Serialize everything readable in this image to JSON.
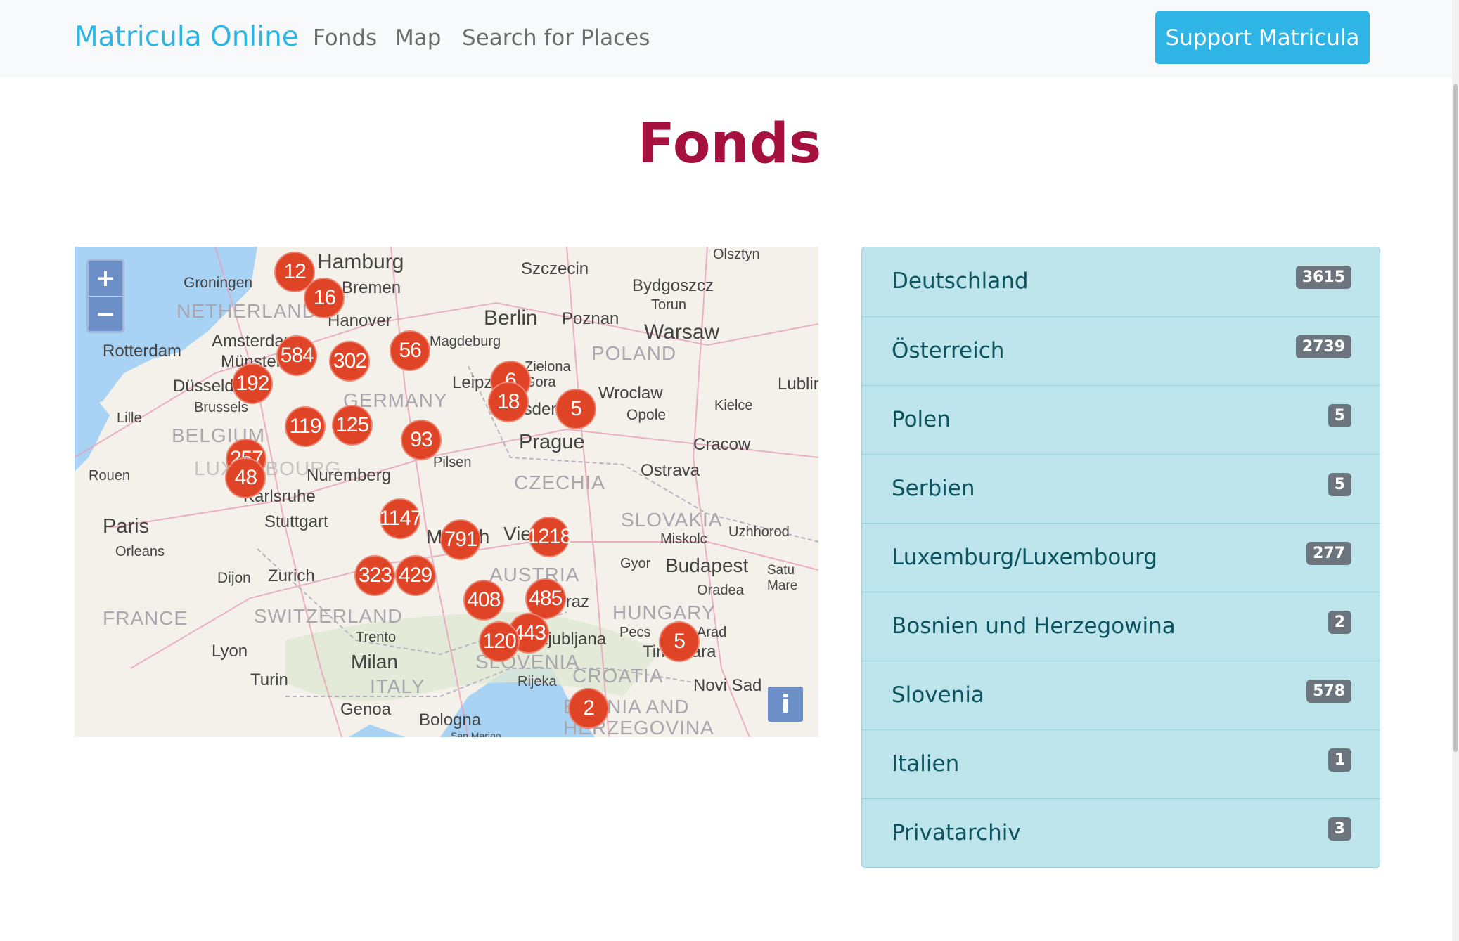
{
  "navbar": {
    "brand": "Matricula Online",
    "links": [
      "Fonds",
      "Map",
      "Search for Places"
    ],
    "support_button": "Support Matricula"
  },
  "page_title": "Fonds",
  "map": {
    "zoom_in": "+",
    "zoom_out": "−",
    "info": "i",
    "clusters": [
      "12",
      "16",
      "584",
      "302",
      "56",
      "192",
      "6",
      "18",
      "5",
      "119",
      "125",
      "93",
      "257",
      "48",
      "1147",
      "791",
      "1218",
      "323",
      "429",
      "408",
      "485",
      "443",
      "120",
      "5",
      "2"
    ],
    "cities": [
      "Hamburg",
      "Bremen",
      "Groningen",
      "Hanover",
      "Amsterdam",
      "Rotterdam",
      "Münster",
      "Düsseldorf",
      "Brussels",
      "Lille",
      "Berlin",
      "Poznan",
      "Szczecin",
      "Bydgoszcz",
      "Torun",
      "Olsztyn",
      "Warsaw",
      "Magdeburg",
      "Leipzig",
      "Zielona Gora",
      "Dresden",
      "Wroclaw",
      "Opole",
      "Kielce",
      "Lublin",
      "Prague",
      "Pilsen",
      "Cracow",
      "Ostrava",
      "Nuremberg",
      "Karlsruhe",
      "Stuttgart",
      "Rouen",
      "Paris",
      "Orleans",
      "Dijon",
      "Zurich",
      "Munich",
      "Vienna",
      "Miskolc",
      "Uzhhorod",
      "Gyor",
      "Budapest",
      "Satu Mare",
      "Oradea",
      "Graz",
      "Ljubljana",
      "Pecs",
      "Arad",
      "Timisoara",
      "Trento",
      "Milan",
      "Turin",
      "Lyon",
      "Rijeka",
      "Novi Sad",
      "Genoa",
      "Bologna",
      "San Marino"
    ],
    "countries": [
      "NETHERLANDS",
      "GERMANY",
      "POLAND",
      "BELGIUM",
      "LUXEMBOURG",
      "CZECHIA",
      "SLOVAKIA",
      "FRANCE",
      "SWITZERLAND",
      "AUSTRIA",
      "HUNGARY",
      "SLOVENIA",
      "CROATIA",
      "ITALY",
      "BOSNIA AND HERZEGOVINA"
    ]
  },
  "fonds_list": [
    {
      "label": "Deutschland",
      "count": "3615"
    },
    {
      "label": "Österreich",
      "count": "2739"
    },
    {
      "label": "Polen",
      "count": "5"
    },
    {
      "label": "Serbien",
      "count": "5"
    },
    {
      "label": "Luxemburg/Luxembourg",
      "count": "277"
    },
    {
      "label": "Bosnien und Herzegowina",
      "count": "2"
    },
    {
      "label": "Slovenia",
      "count": "578"
    },
    {
      "label": "Italien",
      "count": "1"
    },
    {
      "label": "Privatarchiv",
      "count": "3"
    }
  ],
  "colors": {
    "brand": "#2fb4e6",
    "title": "#a5103f",
    "marker": "#e04427",
    "list_bg": "#bee5eb"
  }
}
